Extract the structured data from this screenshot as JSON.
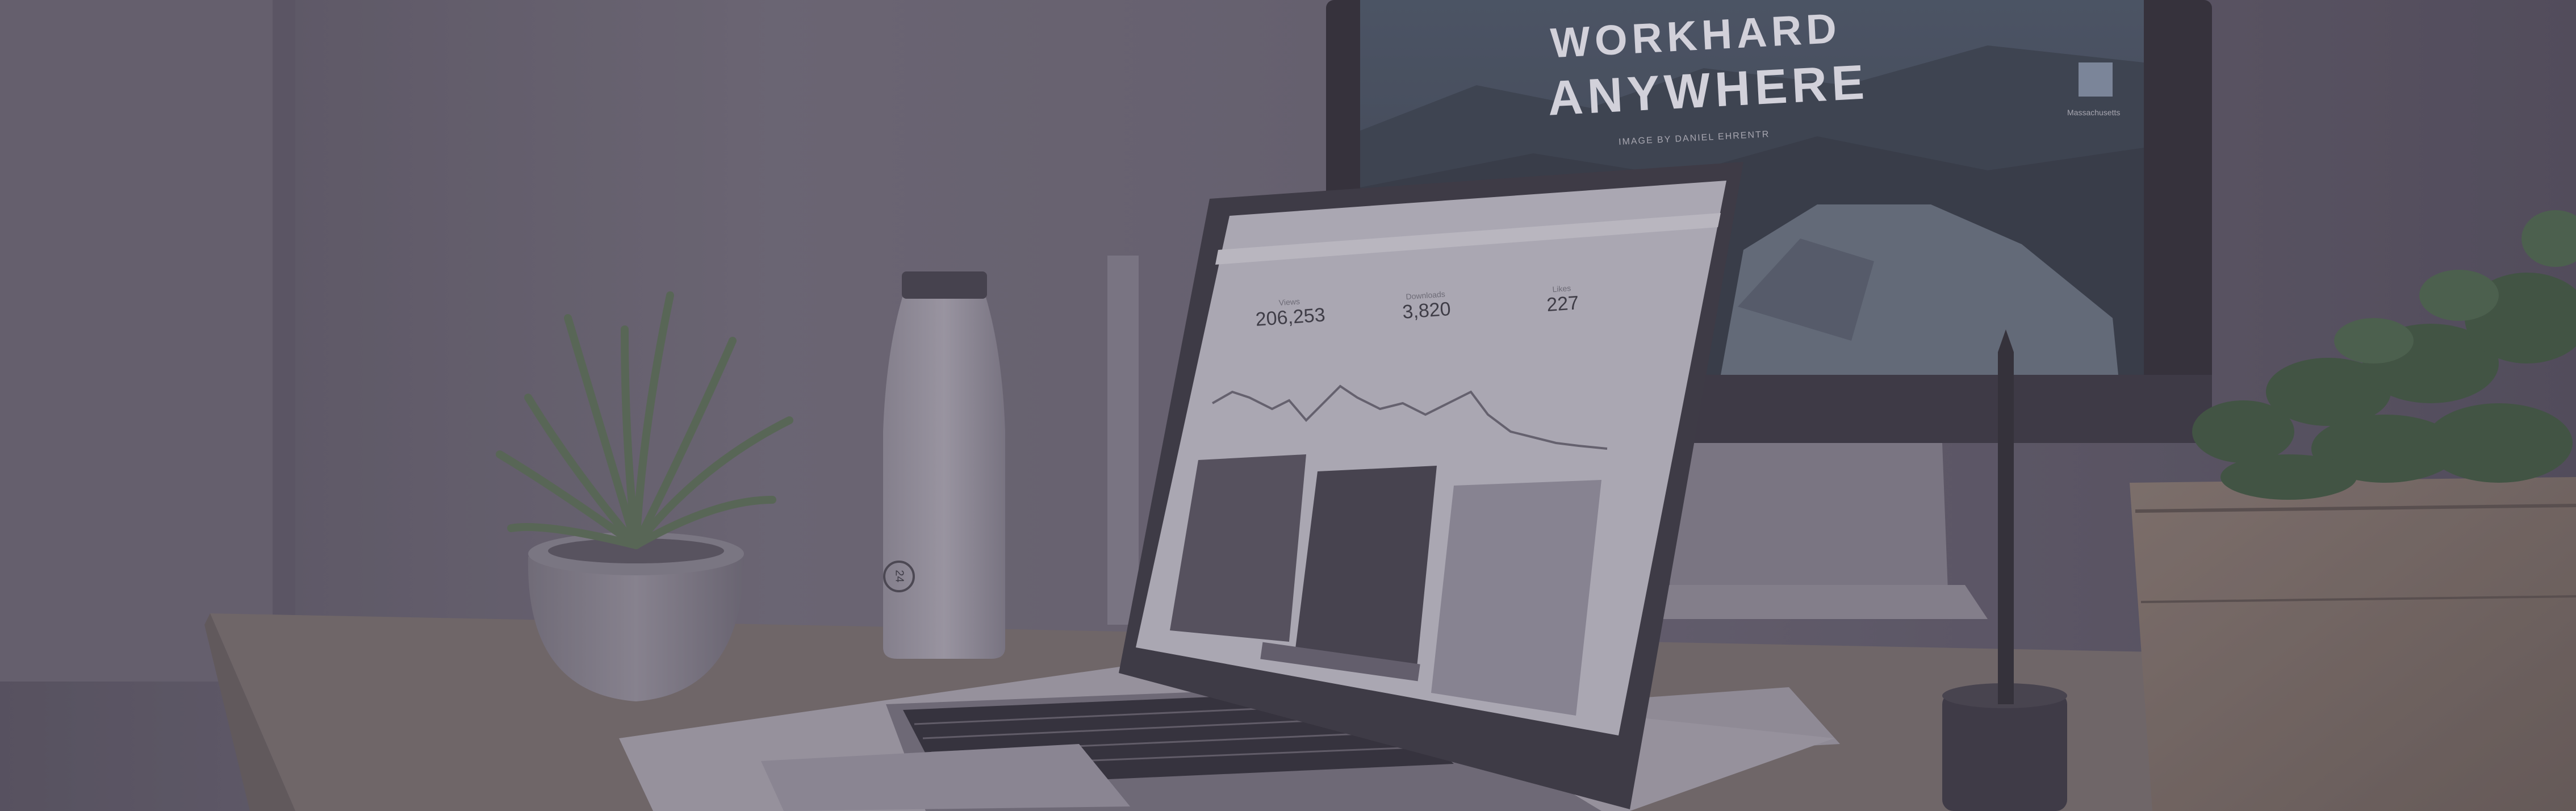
{
  "monitor": {
    "headline_line1": "WORKHARD",
    "headline_line2": "ANYWHERE",
    "credit": "IMAGE BY DANIEL EHRENTR",
    "side_label": "Massachusetts"
  },
  "laptop": {
    "stats": [
      {
        "label": "Views",
        "value": "206,253"
      },
      {
        "label": "Downloads",
        "value": "3,820"
      },
      {
        "label": "Likes",
        "value": "227"
      }
    ]
  },
  "bottle": {
    "logo_text": "24"
  },
  "colors": {
    "overlay": "#4b4656",
    "wood": "#8a7a6c",
    "wall": "#6c6874",
    "screen": "#d7d6de"
  }
}
